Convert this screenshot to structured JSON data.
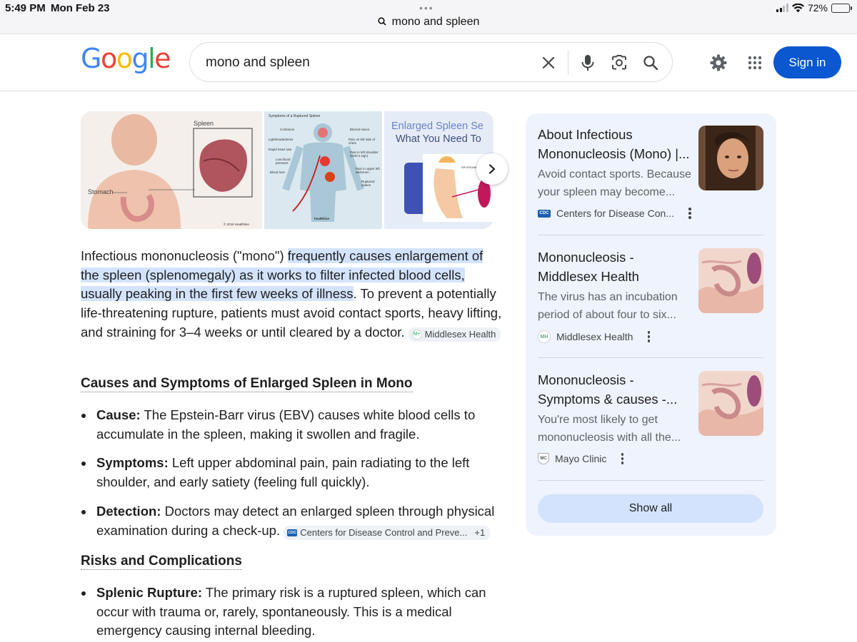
{
  "status_bar": {
    "time": "5:49 PM",
    "date": "Mon Feb 23",
    "url_text": "mono and spleen",
    "battery": "72%",
    "battery_level": 0.72
  },
  "header": {
    "logo_letters": [
      "G",
      "o",
      "o",
      "g",
      "l",
      "e"
    ],
    "logo_colors": [
      "#4285F4",
      "#EA4335",
      "#FBBC05",
      "#4285F4",
      "#34A853",
      "#EA4335"
    ],
    "search_value": "mono and spleen",
    "signin_label": "Sign in"
  },
  "images": {
    "img1": {
      "label_spleen": "Spleen",
      "label_stomach": "Stomach",
      "credit": "© 2018 Healthline"
    },
    "img2": {
      "title": "Symptoms of a Ruptured Spleen",
      "left_labels": [
        "Confusion",
        "Lightheadedness",
        "Rapid heart rate",
        "Low blood pressure",
        "Blood loss"
      ],
      "right_labels": [
        "Blurred vision",
        "Pain on left side of chest",
        "Pain in left shoulder (Kehr's sign)",
        "Pain in upper left abdomen",
        "Ruptured spleen"
      ],
      "credit": "healthline"
    },
    "img3": {
      "title_line1": "Enlarged Spleen Se",
      "title_line2": "What You Need To",
      "inner_label": "SPLENOMEG"
    }
  },
  "overview": {
    "text_start": "Infectious mononucleosis (\"mono\") ",
    "highlight": "frequently causes enlargement of the spleen (splenomegaly) as it works to filter infected blood cells, usually peaking in the first few weeks of illness",
    "text_end": ". To prevent a potentially life-threatening rupture, patients must avoid contact sports, heavy lifting, and straining for 3–4 weeks or until cleared by a doctor.",
    "chip": "Middlesex Health"
  },
  "section1": {
    "heading": "Causes and Symptoms of Enlarged Spleen in Mono",
    "items": [
      {
        "label": "Cause:",
        "text": " The Epstein-Barr virus (EBV) causes white blood cells to accumulate in the spleen, making it swollen and fragile."
      },
      {
        "label": "Symptoms:",
        "text": " Left upper abdominal pain, pain radiating to the left shoulder, and early satiety (feeling full quickly)."
      },
      {
        "label": "Detection:",
        "text": " Doctors may detect an enlarged spleen through physical examination during a check-up."
      }
    ],
    "detection_chip": "Centers for Disease Control and Preve...",
    "detection_chip_count": "+1"
  },
  "section2": {
    "heading": "Risks and Complications",
    "items": [
      {
        "label": "Splenic Rupture:",
        "text": " The primary risk is a ruptured spleen, which can occur with trauma or, rarely, spontaneously. This is a medical emergency causing internal bleeding."
      }
    ]
  },
  "sidebar": {
    "cards": [
      {
        "title": "About Infectious Mononucleosis (Mono) |...",
        "snippet": "Avoid contact sports. Because your spleen may become...",
        "source": "Centers for Disease Con...",
        "favicon": "CDC"
      },
      {
        "title": "Mononucleosis - Middlesex Health",
        "snippet": "The virus has an incubation period of about four to six...",
        "source": "Middlesex Health",
        "favicon": "MH"
      },
      {
        "title": "Mononucleosis - Symptoms & causes -...",
        "snippet": "You're most likely to get mononucleosis with all the...",
        "source": "Mayo Clinic",
        "favicon": "MC"
      }
    ],
    "show_all_label": "Show all"
  }
}
